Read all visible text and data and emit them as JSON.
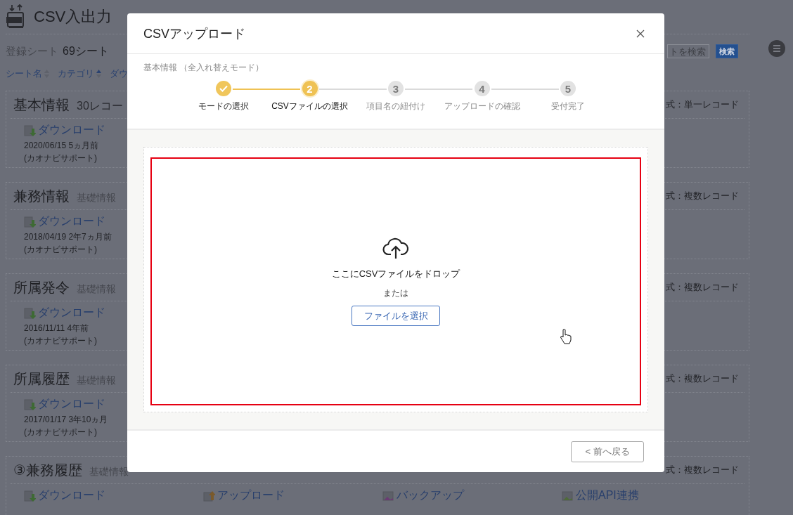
{
  "page": {
    "title": "CSV入出力",
    "sheet_count_label": "登録シート",
    "sheet_count": "69シート",
    "sort_links": [
      {
        "label": "シート名",
        "sorted": false
      },
      {
        "label": "カテゴリ",
        "sorted": true
      },
      {
        "label": "ダウ"
      }
    ],
    "search": {
      "placeholder": "トを検索",
      "button": "検索"
    }
  },
  "sheets": [
    {
      "title": "基本情報",
      "records": "30レコー",
      "format": "式：単一レコード",
      "links": [
        {
          "kind": "download",
          "label": "ダウンロード"
        }
      ],
      "date": "2020/06/15 5ヵ月前",
      "author": "(カオナビサポート)"
    },
    {
      "title": "兼務情報",
      "category": "基礎情報",
      "format": "式：複数レコード",
      "links": [
        {
          "kind": "download",
          "label": "ダウンロード"
        }
      ],
      "date": "2018/04/19 2年7ヵ月前",
      "author": "(カオナビサポート)"
    },
    {
      "title": "所属発令",
      "category": "基礎情報",
      "format": "式：複数レコード",
      "links": [
        {
          "kind": "download",
          "label": "ダウンロード"
        }
      ],
      "date": "2016/11/11 4年前",
      "author": "(カオナビサポート)"
    },
    {
      "title": "所属履歴",
      "category": "基礎情報",
      "format": "式：複数レコード",
      "links": [
        {
          "kind": "download",
          "label": "ダウンロード"
        }
      ],
      "date": "2017/01/17 3年10ヵ月",
      "author": "(カオナビサポート)"
    },
    {
      "title": "③兼務履歴",
      "category": "基礎情報",
      "format": "式：複数レコード",
      "links": [
        {
          "kind": "download",
          "label": "ダウンロード"
        },
        {
          "kind": "upload",
          "label": "アップロード"
        },
        {
          "kind": "backup",
          "label": "バックアップ"
        },
        {
          "kind": "api",
          "label": "公開API連携"
        }
      ]
    }
  ],
  "modal": {
    "title": "CSVアップロード",
    "subtitle": "基本情報 （全入れ替えモード）",
    "steps": [
      {
        "label": "モードの選択",
        "completed": true,
        "selected": false
      },
      {
        "number": "2",
        "label": "CSVファイルの選択",
        "completed": false,
        "selected": true
      },
      {
        "number": "3",
        "label": "項目名の紐付け",
        "completed": false,
        "selected": false
      },
      {
        "number": "4",
        "label": "アップロードの確認",
        "completed": false,
        "selected": false
      },
      {
        "number": "5",
        "label": "受付完了",
        "completed": false,
        "selected": false
      }
    ],
    "drop_zone": {
      "text": "ここにCSVファイルをドロップ",
      "or": "または",
      "button": "ファイルを選択"
    },
    "back_button": "< 前へ戻る"
  }
}
